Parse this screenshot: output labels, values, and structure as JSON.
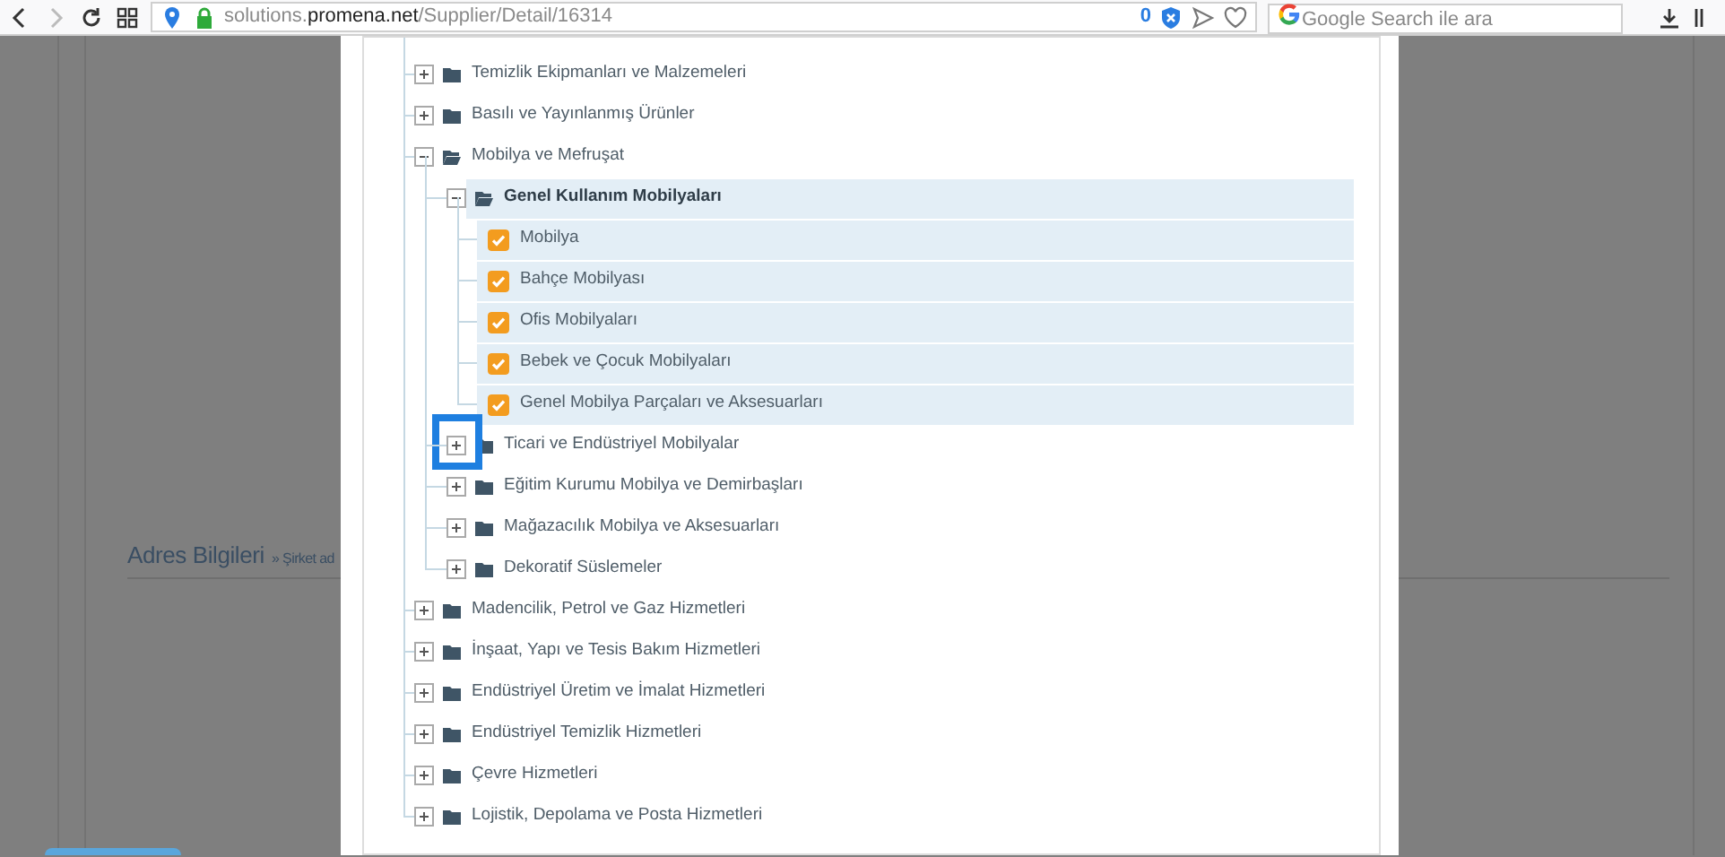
{
  "browser": {
    "url": {
      "subdomain": "solutions.",
      "domain": "promena.net",
      "path": "/Supplier/Detail/16314"
    },
    "counter": "0",
    "search": {
      "placeholder": "Google Search ile ara"
    }
  },
  "background_page": {
    "heading": "Adres Bilgileri",
    "breadcrumb": "» Şirket ad"
  },
  "tree": [
    {
      "label": "Temizlik Ekipmanları ve Malzemeleri",
      "kind": "folder",
      "expanded": false,
      "selected": false,
      "marked": false
    },
    {
      "label": "Basılı ve Yayınlanmış Ürünler",
      "kind": "folder",
      "expanded": false,
      "selected": false,
      "marked": false
    },
    {
      "label": "Mobilya ve Mefruşat",
      "kind": "folder",
      "expanded": true,
      "selected": false,
      "marked": false,
      "children": [
        {
          "label": "Genel Kullanım Mobilyaları",
          "kind": "folder",
          "expanded": true,
          "selected": true,
          "marked": false,
          "children": [
            {
              "label": "Mobilya",
              "kind": "leaf",
              "checked": true
            },
            {
              "label": "Bahçe Mobilyası",
              "kind": "leaf",
              "checked": true
            },
            {
              "label": "Ofis Mobilyaları",
              "kind": "leaf",
              "checked": true
            },
            {
              "label": "Bebek ve Çocuk Mobilyaları",
              "kind": "leaf",
              "checked": true
            },
            {
              "label": "Genel Mobilya Parçaları ve Aksesuarları",
              "kind": "leaf",
              "checked": true
            }
          ]
        },
        {
          "label": "Ticari ve Endüstriyel Mobilyalar",
          "kind": "folder",
          "expanded": false,
          "selected": false,
          "marked": true
        },
        {
          "label": "Eğitim Kurumu Mobilya ve Demirbaşları",
          "kind": "folder",
          "expanded": false,
          "selected": false,
          "marked": false
        },
        {
          "label": "Mağazacılık Mobilya ve Aksesuarları",
          "kind": "folder",
          "expanded": false,
          "selected": false,
          "marked": false
        },
        {
          "label": "Dekoratif Süslemeler",
          "kind": "folder",
          "expanded": false,
          "selected": false,
          "marked": false
        }
      ]
    },
    {
      "label": "Madencilik, Petrol ve Gaz Hizmetleri",
      "kind": "folder",
      "expanded": false,
      "selected": false,
      "marked": false
    },
    {
      "label": "İnşaat, Yapı ve Tesis Bakım Hizmetleri",
      "kind": "folder",
      "expanded": false,
      "selected": false,
      "marked": false
    },
    {
      "label": "Endüstriyel Üretim ve İmalat Hizmetleri",
      "kind": "folder",
      "expanded": false,
      "selected": false,
      "marked": false
    },
    {
      "label": "Endüstriyel Temizlik Hizmetleri",
      "kind": "folder",
      "expanded": false,
      "selected": false,
      "marked": false
    },
    {
      "label": "Çevre Hizmetleri",
      "kind": "folder",
      "expanded": false,
      "selected": false,
      "marked": false
    },
    {
      "label": "Lojistik, Depolama ve Posta Hizmetleri",
      "kind": "folder",
      "expanded": false,
      "selected": false,
      "marked": false
    }
  ]
}
